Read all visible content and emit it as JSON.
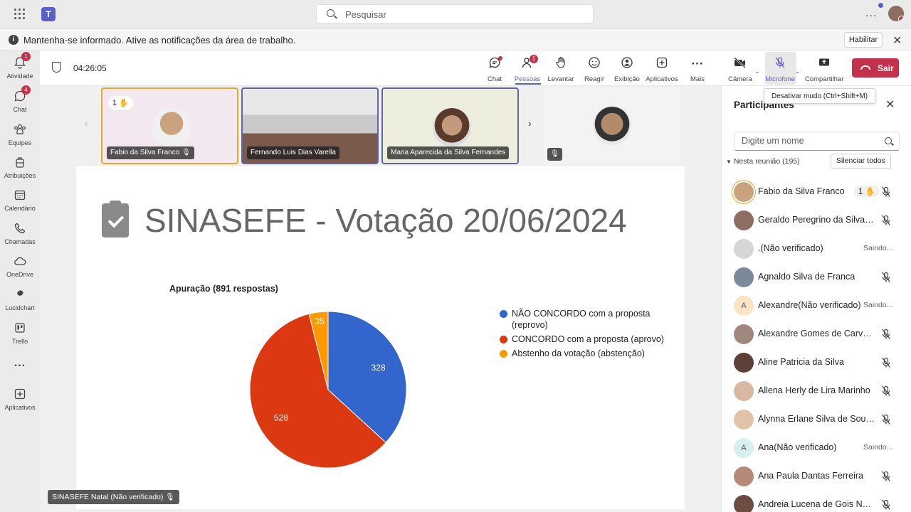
{
  "topbar": {
    "search_placeholder": "Pesquisar",
    "more": "..."
  },
  "notification": {
    "message": "Mantenha-se informado. Ative as notificações da área de trabalho.",
    "enable_label": "Habilitar"
  },
  "rail": [
    {
      "label": "Atividade",
      "icon": "bell-icon",
      "badge": "1"
    },
    {
      "label": "Chat",
      "icon": "chat-icon",
      "badge": "4"
    },
    {
      "label": "Equipes",
      "icon": "teams-icon",
      "badge": ""
    },
    {
      "label": "Atribuições",
      "icon": "backpack-icon",
      "badge": ""
    },
    {
      "label": "Calendário",
      "icon": "calendar-icon",
      "badge": ""
    },
    {
      "label": "Chamadas",
      "icon": "phone-icon",
      "badge": ""
    },
    {
      "label": "OneDrive",
      "icon": "cloud-icon",
      "badge": ""
    },
    {
      "label": "Lucidchart",
      "icon": "lucidchart-icon",
      "badge": ""
    },
    {
      "label": "Trello",
      "icon": "trello-icon",
      "badge": ""
    },
    {
      "label": "...",
      "icon": "more-icon",
      "badge": ""
    },
    {
      "label": "Aplicativos",
      "icon": "add-apps-icon",
      "badge": ""
    }
  ],
  "meeting": {
    "timer": "04:26:05",
    "toolbar": {
      "chat": "Chat",
      "people": "Pessoas",
      "people_count": "1",
      "raise": "Levantar",
      "react": "Reagir",
      "view": "Exibição",
      "apps": "Aplicativos",
      "more": "Mais",
      "camera": "Câmera",
      "mic": "Microfone",
      "share": "Compartilhar",
      "leave": "Sair"
    },
    "tooltip": "Desativar mudo (Ctrl+Shift+M)",
    "tiles": [
      {
        "name": "Fabio da Silva Franco",
        "hand": "1 ✋"
      },
      {
        "name": "Fernando Luis Dias Varella"
      },
      {
        "name": "Maria Aparecida da Silva Fernandes"
      },
      {
        "name": ""
      }
    ],
    "speaker": "SINASEFE Natal (Não verificado)"
  },
  "slide": {
    "title": "SINASEFE - Votação 20/06/2024"
  },
  "chart_data": {
    "type": "pie",
    "title": "Apuração (891 respostas)",
    "categories": [
      "NÃO CONCORDO com a proposta (reprovo)",
      "CONCORDO com a proposta (aprovo)",
      "Abstenho da votação (abstenção)"
    ],
    "values": [
      328,
      528,
      35
    ],
    "colors": [
      "#3366cc",
      "#dc3912",
      "#ff9900"
    ],
    "legend_position": "right"
  },
  "participants": {
    "title": "Participantes",
    "search_placeholder": "Digite um nome",
    "section": "Nesta reunião (195)",
    "mute_all": "Silenciar todos",
    "list": [
      {
        "name": "Fabio da Silva Franco",
        "status": "",
        "hand": "1 ✋",
        "initial": ""
      },
      {
        "name": "Geraldo Peregrino da Silva Neto",
        "status": "",
        "hand": "",
        "initial": ""
      },
      {
        "name": ".(Não verificado)",
        "status": "Saindo...",
        "hand": "",
        "initial": ""
      },
      {
        "name": "Agnaldo Silva de Franca",
        "status": "",
        "hand": "",
        "initial": ""
      },
      {
        "name": "Alexandre(Não verificado)",
        "status": "Saindo...",
        "hand": "",
        "initial": "A"
      },
      {
        "name": "Alexandre Gomes de Carvalho",
        "status": "",
        "hand": "",
        "initial": ""
      },
      {
        "name": "Aline Patricia da Silva",
        "status": "",
        "hand": "",
        "initial": ""
      },
      {
        "name": "Allena Herly de Lira Marinho",
        "status": "",
        "hand": "",
        "initial": ""
      },
      {
        "name": "Alynna Erlane Silva de Sousa ...",
        "status": "",
        "hand": "",
        "initial": ""
      },
      {
        "name": "Ana(Não verificado)",
        "status": "Saindo...",
        "hand": "",
        "initial": "A"
      },
      {
        "name": "Ana Paula Dantas Ferreira",
        "status": "",
        "hand": "",
        "initial": ""
      },
      {
        "name": "Andreia Lucena de Gois Nasci...",
        "status": "",
        "hand": "",
        "initial": ""
      }
    ]
  }
}
